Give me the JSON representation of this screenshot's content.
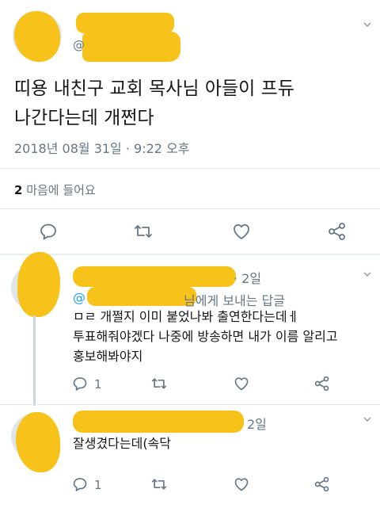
{
  "main_tweet": {
    "text_line1": "띠용 내친구 교회 목사님 아들이 프듀",
    "text_line2": "나간다는데 개쩐다",
    "timestamp": "2018년 08월 31일 · 9:22 오후",
    "likes_count": "2",
    "likes_label": " 마음에 들어요"
  },
  "replies": [
    {
      "time": "· 2일",
      "reply_to_suffix": "님에게 보내는 답글",
      "line1": "ㅁㄹ 개쩔지 이미 붙었나봐 출연한다는데ㅔ",
      "line2": "투표해줘야겠다 나중에 방송하면 내가 이름 알리고",
      "line3": "홍보해봐야지",
      "reply_count": "1"
    },
    {
      "time": "2일",
      "line1": "잘생겼다는데(속닥",
      "reply_count": "1"
    }
  ],
  "icons": {
    "reply": "reply-bubble-icon",
    "retweet": "retweet-icon",
    "like": "heart-icon",
    "share": "share-icon",
    "more": "chevron-down-icon"
  },
  "colors": {
    "redaction": "#f7c21a",
    "meta": "#657786",
    "divider": "#e1e8ed",
    "thread_line": "#ccd6dd"
  }
}
